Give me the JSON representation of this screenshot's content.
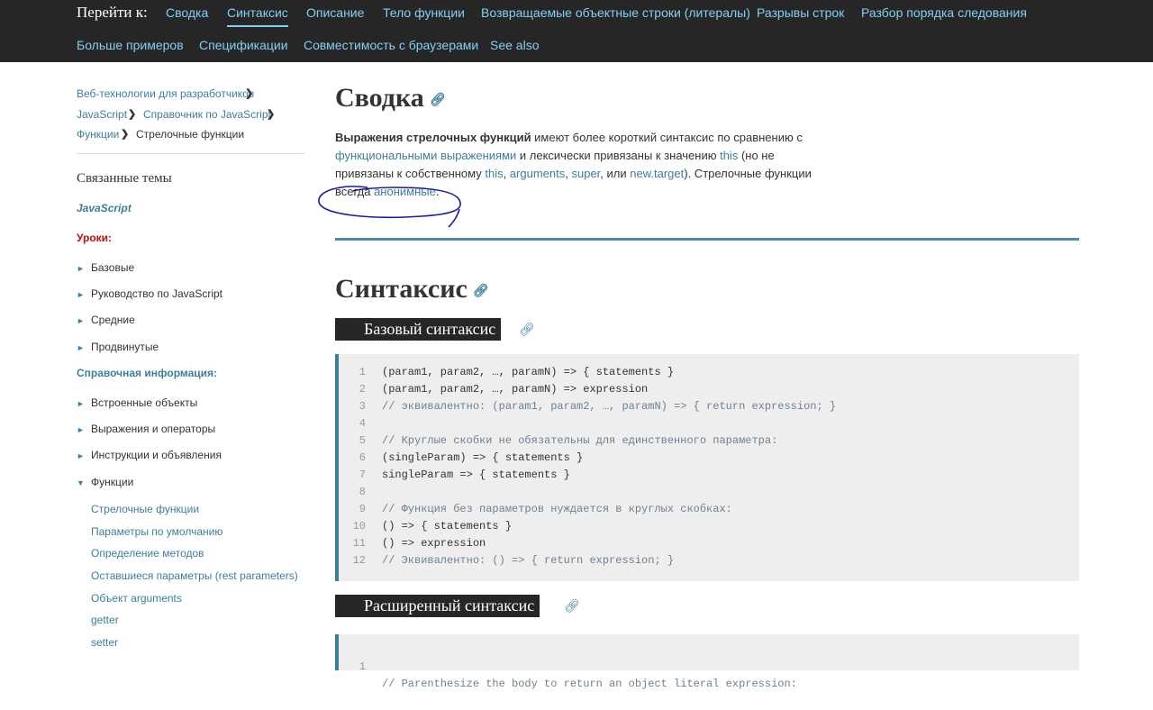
{
  "topnav": {
    "goto_label": "Перейти к:",
    "links_row1": [
      "Сводка",
      "Синтаксис",
      "Описание",
      "Тело функции",
      "Возвращаемые объектные строки (литералы)",
      "Разрывы строк",
      "Разбор порядка следования"
    ],
    "links_row2": [
      "Больше примеров",
      "Спецификации",
      "Совместимость с браузерами",
      "See also"
    ],
    "active": "Синтаксис"
  },
  "breadcrumbs": [
    "Веб-технологии для разработчиков",
    "JavaScript",
    "Справочник по JavaScript",
    "Функции",
    "Стрелочные функции"
  ],
  "sidebar": {
    "heading": "Связанные темы",
    "js_label": "JavaScript",
    "lessons_label": "Уроки:",
    "lessons": [
      "Базовые",
      "Руководство по JavaScript",
      "Средние",
      "Продвинутые"
    ],
    "reference_label": "Справочная информация:",
    "reference": [
      "Встроенные объекты",
      "Выражения и операторы",
      "Инструкции и объявления",
      "Функции"
    ],
    "functions_sub": [
      "Стрелочные функции",
      "Параметры по умолчанию",
      "Определение методов",
      "Оставшиеся параметры (rest parameters)",
      "Объект arguments",
      "getter",
      "setter"
    ]
  },
  "main": {
    "summary_title": "Сводка",
    "summary": {
      "bold": "Выражения стрелочных функций",
      "t1": " имеют более короткий синтаксис по сравнению с ",
      "l1": "функциональными выражениями",
      "t2": " и лексически привязаны к значению ",
      "l2": "this",
      "t3": " (но не привязаны к собственному ",
      "l3": "this",
      "t4": ", ",
      "l4": "arguments",
      "t5": ", ",
      "l5": "super",
      "t6": ", или ",
      "l6": "new.target",
      "t7": "). Стрелочные функции всегда ",
      "l7": "анонимные",
      "t8": "."
    },
    "syntax_title": "Синтаксис",
    "basic_title": "Базовый синтаксис",
    "basic_code": [
      {
        "n": "1",
        "text": "(param1, param2, …, paramN) => { statements }",
        "comment": false
      },
      {
        "n": "2",
        "text": "(param1, param2, …, paramN) => expression",
        "comment": false
      },
      {
        "n": "3",
        "text": "// эквивалентно: (param1, param2, …, paramN) => { return expression; }",
        "comment": true
      },
      {
        "n": "4",
        "text": "",
        "comment": false
      },
      {
        "n": "5",
        "text": "// Круглые скобки не обязательны для единственного параметра:",
        "comment": true
      },
      {
        "n": "6",
        "text": "(singleParam) => { statements }",
        "comment": false
      },
      {
        "n": "7",
        "text": "singleParam => { statements }",
        "comment": false
      },
      {
        "n": "8",
        "text": "",
        "comment": false
      },
      {
        "n": "9",
        "text": "// Функция без параметров нуждается в круглых скобках:",
        "comment": true
      },
      {
        "n": "10",
        "text": "() => { statements }",
        "comment": false
      },
      {
        "n": "11",
        "text": "() => expression",
        "comment": false
      },
      {
        "n": "12",
        "text": "// Эквивалентно: () => { return expression; }",
        "comment": true
      }
    ],
    "advanced_title": "Расширенный синтаксис",
    "advanced_code_first": "// Parenthesize the body to return an object literal expression:"
  },
  "colors": {
    "nav_bg": "#262626",
    "link": "#3d7e9a",
    "nav_link": "#83d0f2",
    "lessons": "#b80f0f",
    "annotation": "#1a1aa6"
  }
}
